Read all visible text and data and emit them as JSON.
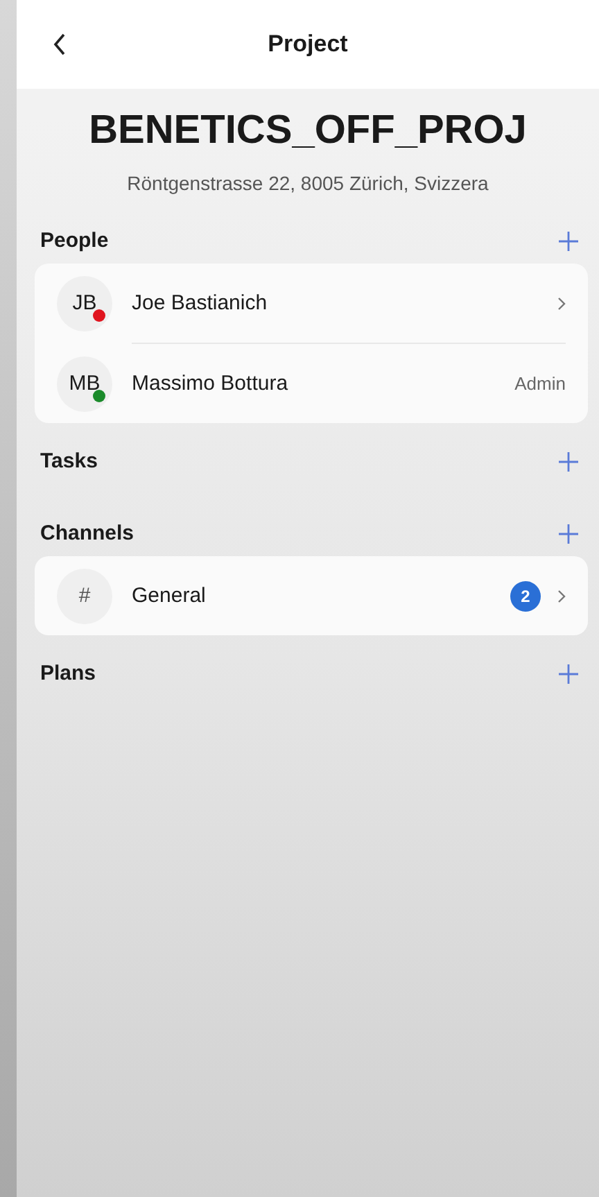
{
  "header": {
    "title": "Project"
  },
  "project": {
    "name": "BENETICS_OFF_PROJ",
    "address": "Röntgenstrasse 22, 8005 Zürich, Svizzera"
  },
  "sections": [
    {
      "title": "People",
      "items": [
        {
          "kind": "person",
          "initials": "JB",
          "name": "Joe Bastianich",
          "color": "#e0141e"
        },
        {
          "kind": "person",
          "initials": "MB",
          "name": "Massimo Bottura",
          "color": "#1a8a2a",
          "role": "Admin"
        }
      ]
    },
    {
      "title": "Tasks"
    },
    {
      "title": "Channels",
      "items": [
        {
          "kind": "channel",
          "symbol": "#",
          "name": "General",
          "badge": "2"
        }
      ]
    },
    {
      "title": "Plans"
    }
  ]
}
